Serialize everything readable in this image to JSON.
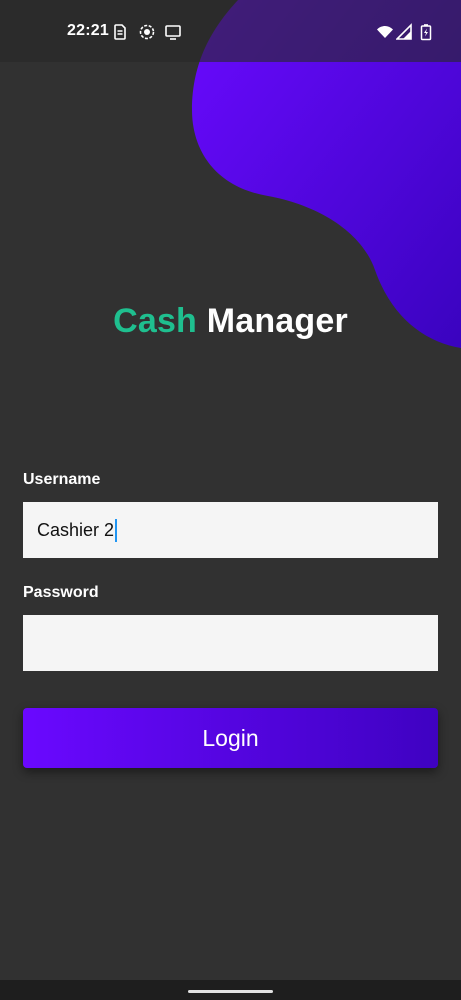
{
  "status_bar": {
    "time": "22:21",
    "left_icons": [
      "sim-card-icon",
      "screen-record-icon",
      "cast-screen-icon"
    ],
    "right_icons": [
      "wifi-icon",
      "cell-signal-icon",
      "battery-charging-icon"
    ]
  },
  "app": {
    "title_accent": "Cash",
    "title_main": "Manager",
    "accent_color": "#1fbf8f",
    "brand_color": "#5a06f0"
  },
  "form": {
    "username_label": "Username",
    "username_value": "Cashier 2",
    "password_label": "Password",
    "password_value": "",
    "login_label": "Login"
  }
}
